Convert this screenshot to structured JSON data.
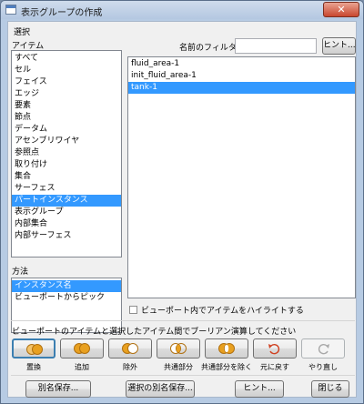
{
  "window": {
    "title": "表示グループの作成",
    "close_symbol": "✕"
  },
  "selection": {
    "group_label": "選択",
    "items_label": "アイテム",
    "items": [
      "すべて",
      "セル",
      "フェイス",
      "エッジ",
      "要素",
      "節点",
      "データム",
      "アセンブリワイヤ",
      "参照点",
      "取り付け",
      "集合",
      "サーフェス",
      "パートインスタンス",
      "表示グループ",
      "内部集合",
      "内部サーフェス"
    ],
    "items_selected_index": 12,
    "method_label": "方法",
    "methods": [
      "インスタンス名",
      "ビューポートからピック"
    ],
    "methods_selected_index": 0,
    "filter_label": "名前のフィルタ:",
    "filter_value": "",
    "hint_button": "ヒント...",
    "instances": [
      "fluid_area-1",
      "init_fluid_area-1",
      "tank-1"
    ],
    "instances_selected_index": 2,
    "highlight_checkbox_label": "ビューポート内でアイテムをハイライトする",
    "highlight_checked": false
  },
  "boolean": {
    "instruction": "ビューポートのアイテムと選択したアイテム間でブーリアン演算してください",
    "tools": [
      {
        "name": "replace-icon",
        "label": "置換"
      },
      {
        "name": "add-icon",
        "label": "追加"
      },
      {
        "name": "remove-icon",
        "label": "除外"
      },
      {
        "name": "intersect-icon",
        "label": "共通部分"
      },
      {
        "name": "exclude-intersect-icon",
        "label": "共通部分を除く"
      },
      {
        "name": "undo-icon",
        "label": "元に戻す"
      },
      {
        "name": "redo-icon",
        "label": "やり直し"
      }
    ]
  },
  "footer": {
    "save_as": "別名保存...",
    "save_selection_as": "選択の別名保存...",
    "hint": "ヒント...",
    "close": "閉じる"
  },
  "colors": {
    "selection": "#3399ff",
    "venn_orange": "#e8a020",
    "undo_red": "#d04020"
  }
}
